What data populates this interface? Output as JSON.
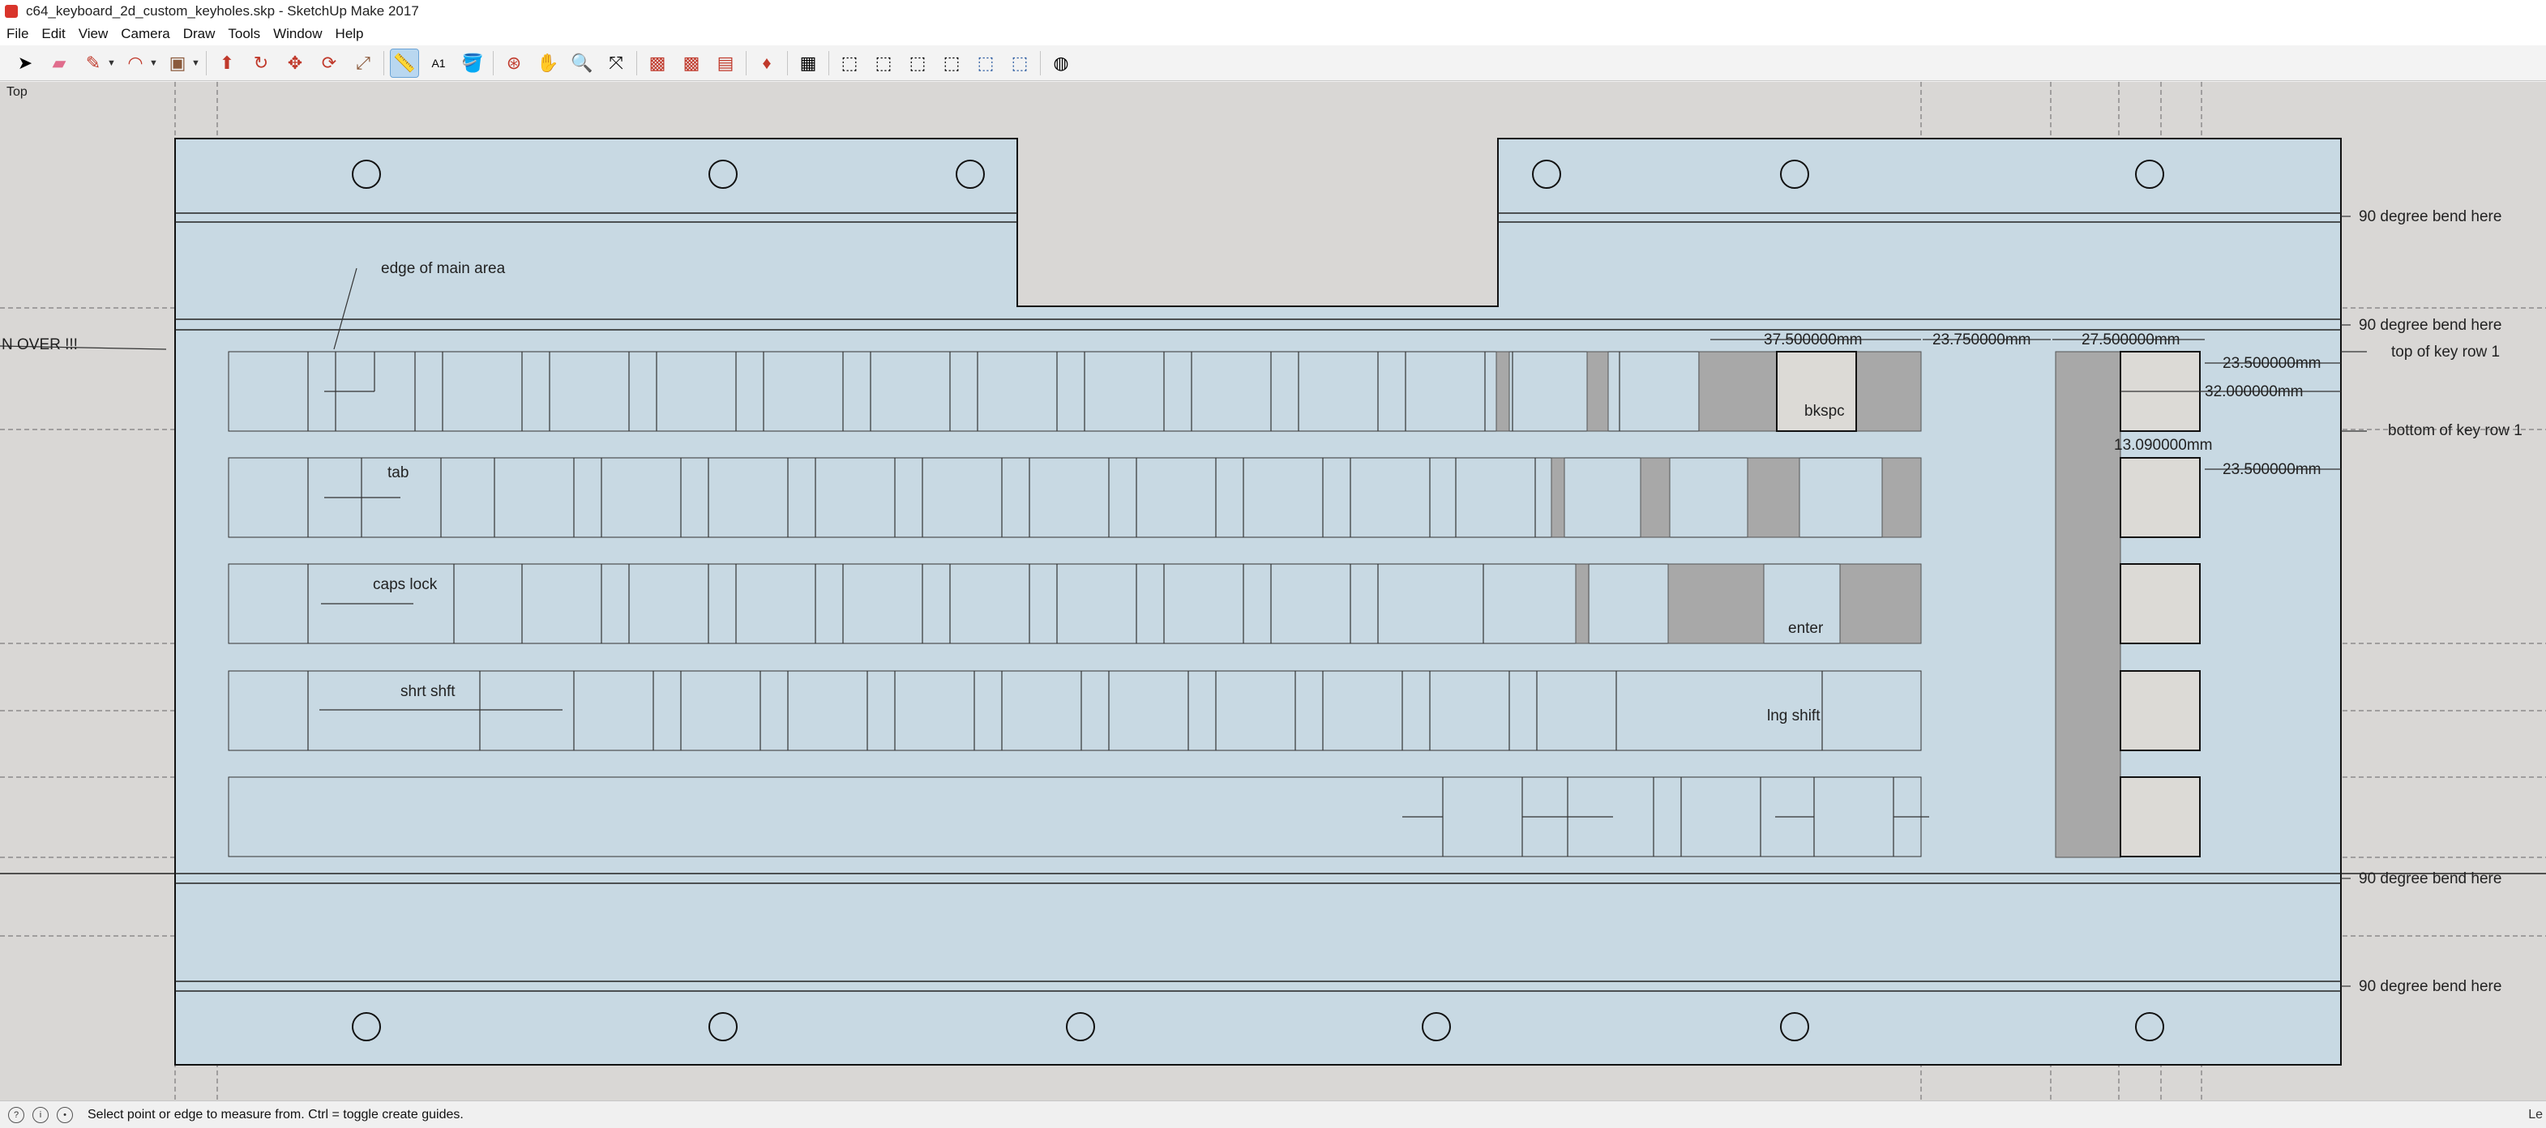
{
  "window": {
    "title": "c64_keyboard_2d_custom_keyholes.skp - SketchUp Make 2017"
  },
  "menu": [
    "File",
    "Edit",
    "View",
    "Camera",
    "Draw",
    "Tools",
    "Window",
    "Help"
  ],
  "toolbar": {
    "tools": [
      "select-tool",
      "eraser-tool",
      "line-tool",
      "arc-tool",
      "shape-tool",
      "push-pull-tool",
      "follow-me-tool",
      "move-tool",
      "rotate-tool",
      "scale-tool",
      "tape-measure-tool",
      "text-tool",
      "paint-bucket-tool",
      "orbit-tool",
      "pan-tool",
      "zoom-tool",
      "zoom-extents-tool",
      "3d-warehouse-tool",
      "extension-warehouse-tool",
      "layout-tool",
      "ruby-console-tool",
      "components-tool",
      "iso-view",
      "top-view",
      "front-view",
      "right-view",
      "back-view",
      "left-view",
      "model-info-tool"
    ]
  },
  "viewport": {
    "scene_label": "Top"
  },
  "annotations": {
    "bend_labels": [
      "90 degree bend here",
      "90 degree bend here",
      "90 degree bend here",
      "90 degree bend here"
    ],
    "edge_main_area": "edge of main area",
    "over_text": "N OVER !!!",
    "top_key_row": "top of key row 1",
    "bottom_key_row": "bottom of key row 1",
    "key_labels": {
      "bkspc": "bkspc",
      "tab": "tab",
      "caps_lock": "caps lock",
      "enter": "enter",
      "shrt_shft": "shrt shft",
      "lng_shift": "lng shift"
    },
    "dimensions": {
      "d1": "37.500000mm",
      "d2": "23.750000mm",
      "d3": "27.500000mm",
      "d4": "23.500000mm",
      "d5": "32.000000mm",
      "d6": "13.090000mm",
      "d7": "23.500000mm"
    }
  },
  "status": {
    "text": "Select point or edge to measure from.  Ctrl = toggle create guides.",
    "measurement_label": "Le"
  },
  "colors": {
    "panel": "#c8d9e3",
    "viewport_bg": "#d9d7d5",
    "gray_key": "#a8a8a8",
    "guide": "#555555"
  }
}
